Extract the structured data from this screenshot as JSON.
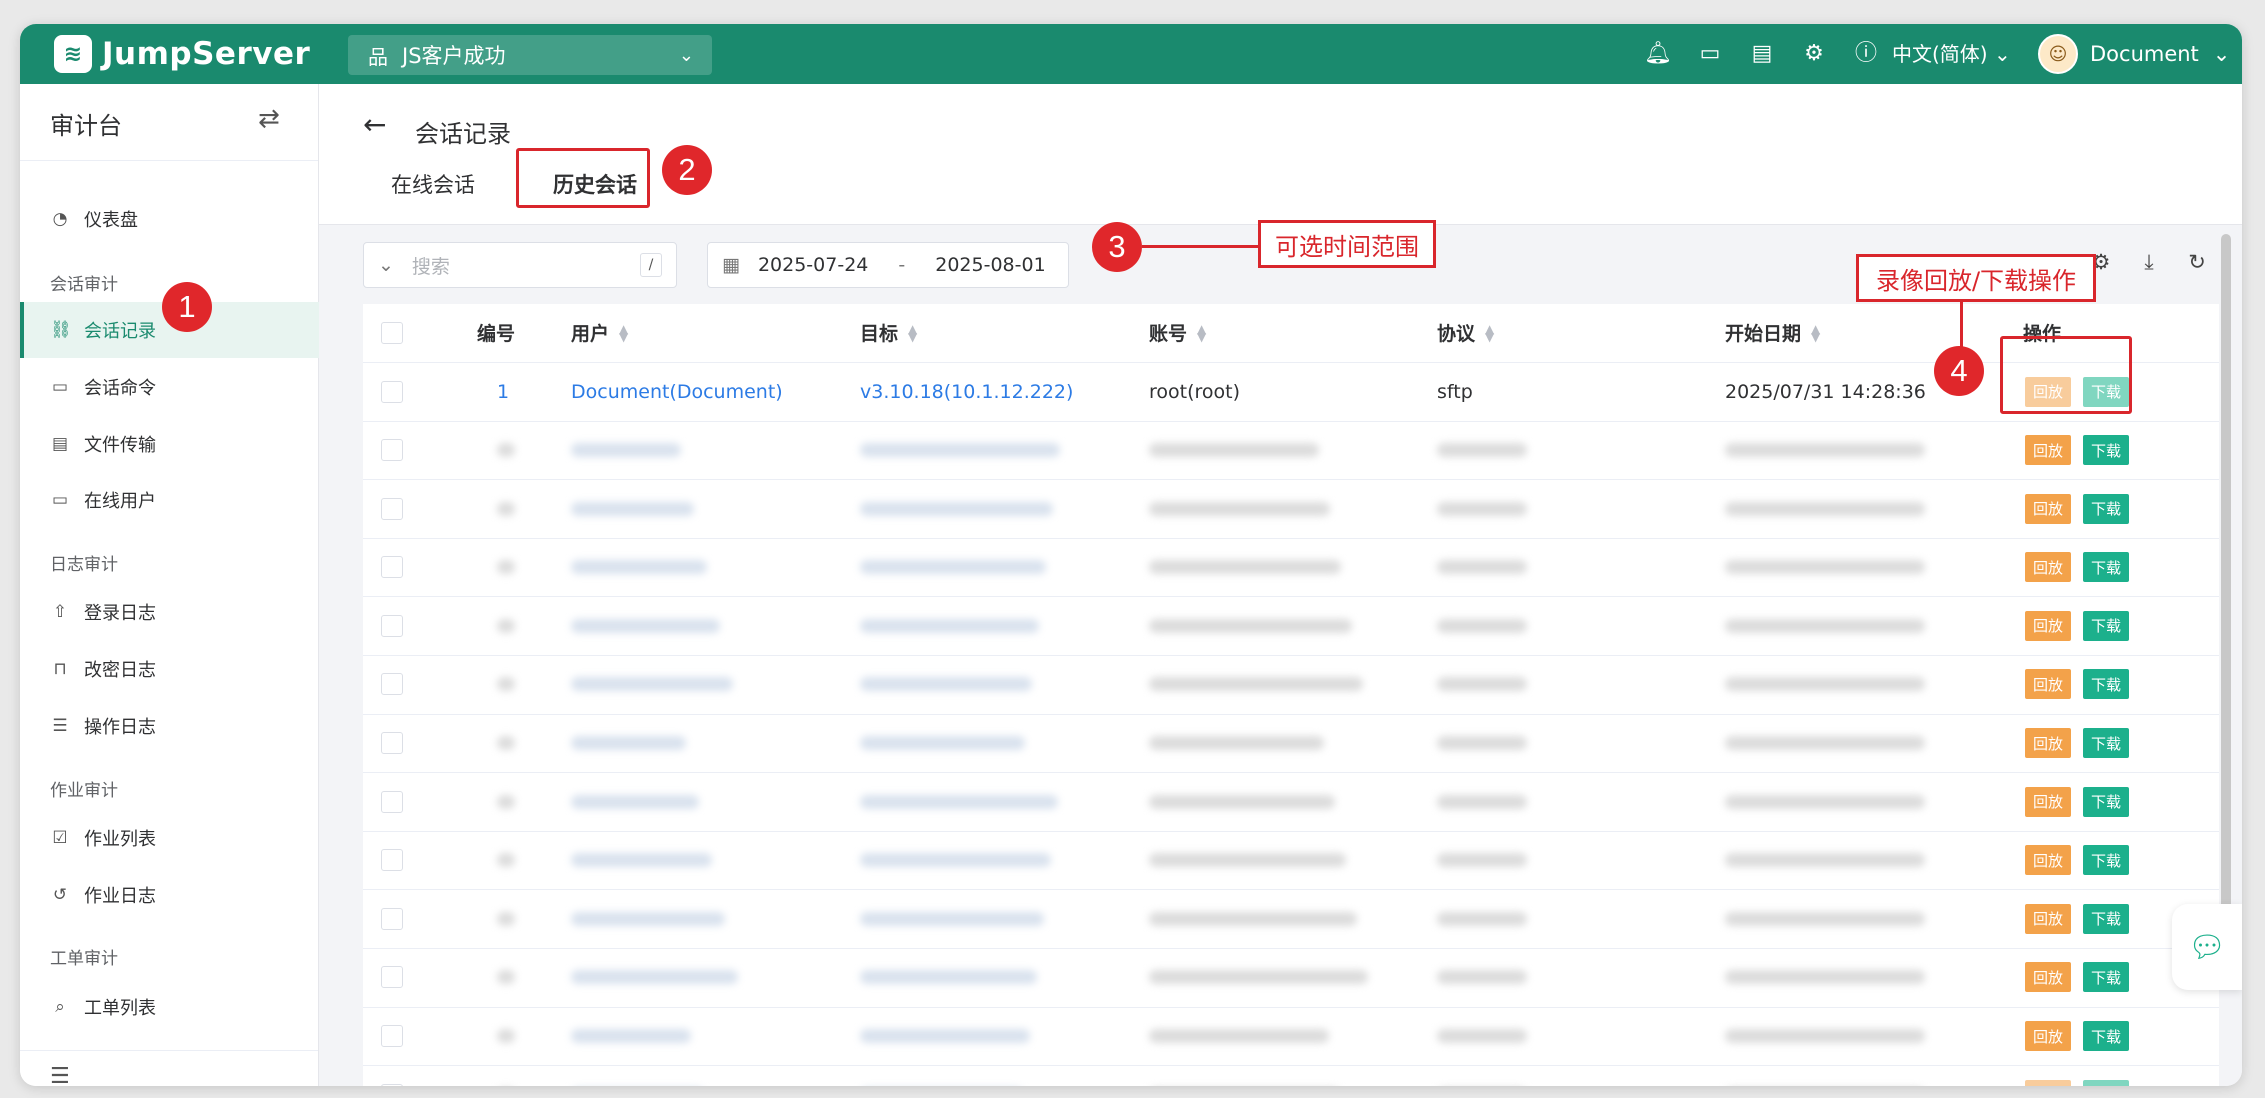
{
  "app": {
    "name": "JumpServer"
  },
  "org": {
    "name": "JS客户成功"
  },
  "lang": "中文(简体)",
  "user": {
    "name": "Document"
  },
  "sidebar": {
    "title": "审计台",
    "groups": [
      {
        "label": "会话审计",
        "items": [
          {
            "label": "仪表盘",
            "icon": "dashboard-icon"
          },
          {
            "label": "会话记录",
            "icon": "link-icon",
            "active": true
          },
          {
            "label": "会话命令",
            "icon": "terminal-icon"
          },
          {
            "label": "文件传输",
            "icon": "file-icon"
          },
          {
            "label": "在线用户",
            "icon": "monitor-user-icon"
          }
        ]
      },
      {
        "label": "日志审计",
        "items": [
          {
            "label": "登录日志",
            "icon": "login-icon"
          },
          {
            "label": "改密日志",
            "icon": "lock-icon"
          },
          {
            "label": "操作日志",
            "icon": "list-icon"
          }
        ]
      },
      {
        "label": "作业审计",
        "items": [
          {
            "label": "作业列表",
            "icon": "clipboard-icon"
          },
          {
            "label": "作业日志",
            "icon": "history-icon"
          }
        ]
      },
      {
        "label": "工单审计",
        "items": [
          {
            "label": "工单列表",
            "icon": "ticket-icon"
          }
        ]
      }
    ]
  },
  "page": {
    "title": "会话记录",
    "tabs": [
      {
        "label": "在线会话",
        "active": false
      },
      {
        "label": "历史会话",
        "active": true
      }
    ]
  },
  "filters": {
    "search_placeholder": "搜索",
    "search_shortcut": "/",
    "date_start": "2025-07-24",
    "date_separator": "-",
    "date_end": "2025-08-01"
  },
  "table": {
    "columns": [
      "编号",
      "用户",
      "目标",
      "账号",
      "协议",
      "开始日期",
      "操作"
    ],
    "first_row": {
      "id": "1",
      "user": "Document(Document)",
      "target": "v3.10.18(10.1.12.222)",
      "account": "root(root)",
      "protocol": "sftp",
      "start_date": "2025/07/31 14:28:36"
    },
    "actions": {
      "replay": "回放",
      "download": "下载"
    },
    "blurred_row_count": 12
  },
  "annotations": {
    "n1": "1",
    "n2": "2",
    "n3": "3",
    "n3_text": "可选时间范围",
    "n4": "4",
    "n4_text": "录像回放/下载操作"
  },
  "colors": {
    "brand": "#1a8a6e",
    "annotation": "#d9262c",
    "replay": "#f3a24a",
    "download": "#1cb08c",
    "link": "#2c7be5"
  }
}
